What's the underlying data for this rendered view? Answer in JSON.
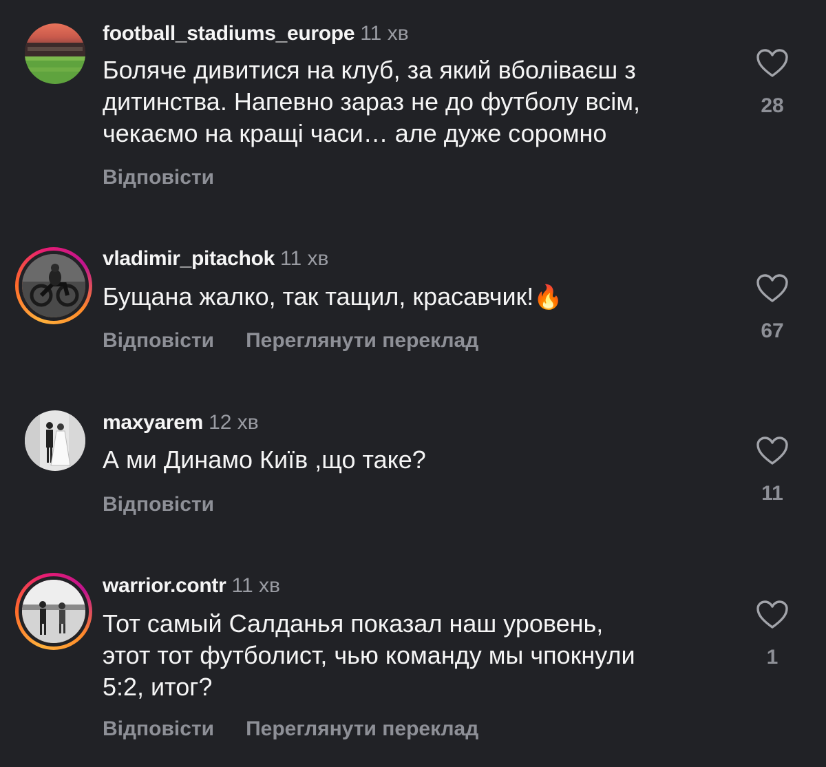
{
  "comments": [
    {
      "username": "football_stadiums_europe",
      "time": "11 хв",
      "text_lines": [
        "Боляче дивитися на клуб, за який вболіваєш з",
        "дитинства. Напевно зараз не до футболу всім,",
        "чекаємо на кращі часи… але дуже соромно"
      ],
      "reply_label": "Відповісти",
      "likes": "28"
    },
    {
      "username": "vladimir_pitachok",
      "time": "11 хв",
      "text": "Бущана жалко, так тащил, красавчик!",
      "emoji": "🔥",
      "reply_label": "Відповісти",
      "translate_label": "Переглянути переклад",
      "likes": "67"
    },
    {
      "username": "maxyarem",
      "time": "12 хв",
      "text": "А ми Динамо Київ ,що таке?",
      "reply_label": "Відповісти",
      "likes": "11"
    },
    {
      "username": "warrior.contr",
      "time": "11 хв",
      "text_lines": [
        "Тот самый Салданья показал наш уровень,",
        "этот тот футболист, чью команду мы чпокнули",
        "5:2, итог?"
      ],
      "reply_label": "Відповісти",
      "translate_label": "Переглянути переклад",
      "likes": "1"
    }
  ],
  "colors": {
    "background": "#212226",
    "primary_text": "#f5f5f5",
    "secondary_text": "#8e9097"
  }
}
